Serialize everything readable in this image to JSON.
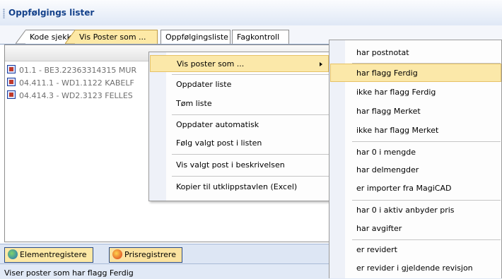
{
  "panel": {
    "title": "Oppfølgings lister"
  },
  "tabs": [
    {
      "label": "Kode sjekk"
    },
    {
      "label": "Vis Poster som ..."
    },
    {
      "label": "Oppfølgingsliste"
    },
    {
      "label": "Fagkontroll"
    }
  ],
  "list": {
    "rows": [
      {
        "text": "01.1 - BE3.22363314315  MUR"
      },
      {
        "text": "04.411.1 - WD1.1122  KABELF"
      },
      {
        "text": "04.414.3 - WD2.3123  FELLES"
      }
    ]
  },
  "context_menu": {
    "items": [
      {
        "label": "Vis poster som ...",
        "has_submenu": true
      },
      {
        "label": "Oppdater liste"
      },
      {
        "label": "Tøm liste"
      },
      {
        "label": "Oppdater automatisk"
      },
      {
        "label": "Følg valgt post i listen"
      },
      {
        "label": "Vis valgt post i beskrivelsen"
      },
      {
        "label": "Kopier til utklippstavlen (Excel)"
      }
    ]
  },
  "submenu": {
    "items": [
      {
        "label": "har postnotat"
      },
      {
        "label": "har flagg Ferdig"
      },
      {
        "label": "ikke har flagg Ferdig"
      },
      {
        "label": "har flagg Merket"
      },
      {
        "label": "ikke har flagg Merket"
      },
      {
        "label": "har 0 i mengde"
      },
      {
        "label": "har delmengder"
      },
      {
        "label": "er importer fra MagiCAD"
      },
      {
        "label": "har 0 i aktiv anbyder pris"
      },
      {
        "label": "har avgifter"
      },
      {
        "label": "er revidert"
      },
      {
        "label": "er revider i gjeldende revisjon"
      }
    ]
  },
  "bottom_tabs": [
    {
      "label": "Elementregistere",
      "icon": "element-register-icon"
    },
    {
      "label": "Prisregistrere",
      "icon": "price-register-icon"
    }
  ],
  "status": {
    "text": "Viser poster som har flagg Ferdig"
  },
  "colors": {
    "highlight": "#fbe8a9",
    "title_text": "#15428b",
    "active_tab": "#fde9a6"
  }
}
